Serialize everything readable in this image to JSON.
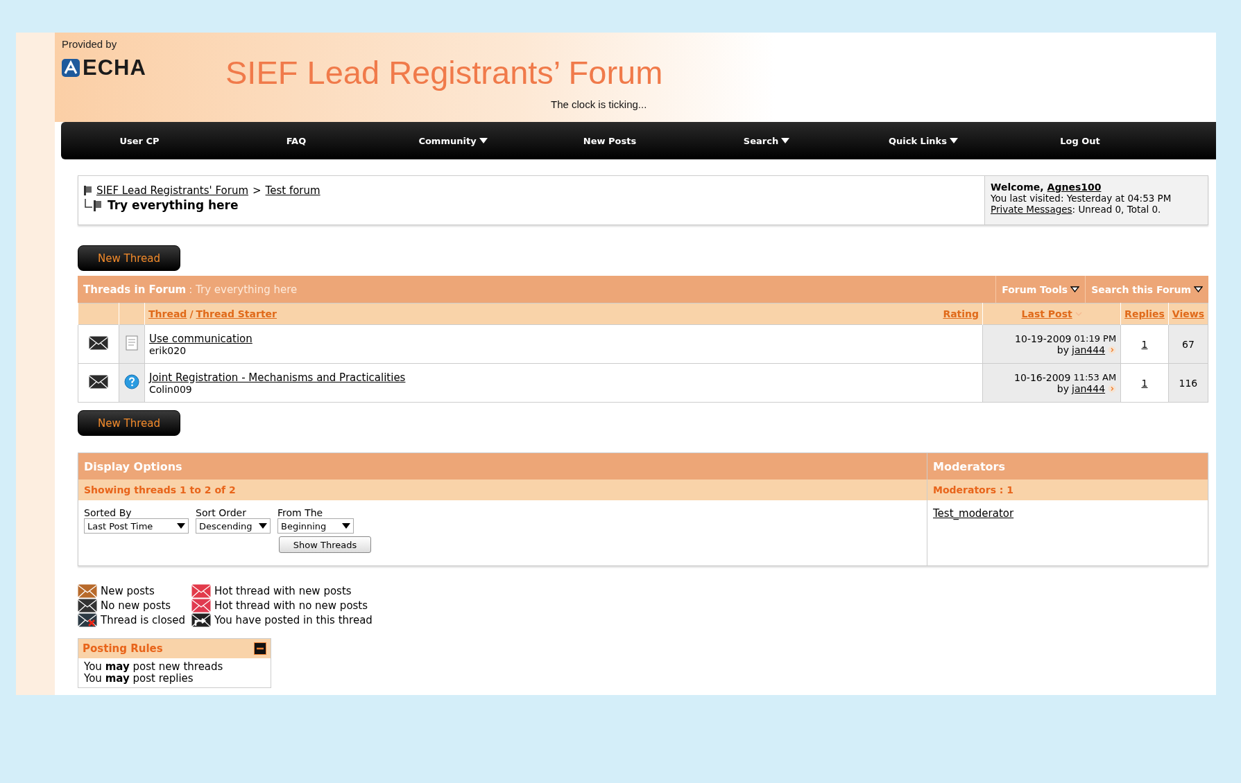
{
  "header": {
    "provided_by": "Provided by",
    "logo": "ECHA",
    "title": "SIEF Lead Registrants’ Forum",
    "tagline": "The clock is ticking..."
  },
  "nav": [
    {
      "label": "User CP",
      "dropdown": false
    },
    {
      "label": "FAQ",
      "dropdown": false
    },
    {
      "label": "Community",
      "dropdown": true
    },
    {
      "label": "New Posts",
      "dropdown": false
    },
    {
      "label": "Search",
      "dropdown": true
    },
    {
      "label": "Quick Links",
      "dropdown": true
    },
    {
      "label": "Log Out",
      "dropdown": false
    }
  ],
  "breadcrumb": {
    "parent": "SIEF Lead Registrants' Forum",
    "separator": ">",
    "child": "Test forum",
    "current": "Try everything here"
  },
  "welcome": {
    "greeting": "Welcome,",
    "user": "Agnes100",
    "line2": "You last visited: Yesterday at 04:53 PM",
    "pm_link": "Private Messages",
    "pm_status": ": Unread 0, Total 0."
  },
  "new_thread_button": "New Thread",
  "threads": {
    "title": "Threads in Forum",
    "subtitle": ": Try everything here",
    "tools": [
      "Forum Tools",
      "Search this Forum"
    ],
    "columns": {
      "thread": "Thread",
      "sep": "/",
      "starter": "Thread Starter",
      "rating": "Rating",
      "last_post": "Last Post",
      "replies": "Replies",
      "views": "Views"
    },
    "rows": [
      {
        "kind": "document",
        "title": "Use communication",
        "starter": "erik020",
        "date": "10-19-2009",
        "time": "01:19 PM",
        "by": "by",
        "last_user": "jan444",
        "replies": "1",
        "views": "67"
      },
      {
        "kind": "question",
        "title": "Joint Registration - Mechanisms and Practicalities",
        "starter": "Colin009",
        "date": "10-16-2009",
        "time": "11:53 AM",
        "by": "by",
        "last_user": "jan444",
        "replies": "1",
        "views": "116"
      }
    ]
  },
  "new_thread_button_2": "New Thread",
  "display_options": {
    "title": "Display Options",
    "showing": "Showing threads 1 to 2 of 2",
    "fields": [
      {
        "label": "Sorted By",
        "value": "Last Post Time"
      },
      {
        "label": "Sort Order",
        "value": "Descending"
      },
      {
        "label": "From The",
        "value": "Beginning"
      }
    ],
    "button": "Show Threads"
  },
  "moderators": {
    "title": "Moderators",
    "count": "Moderators : 1",
    "names": [
      "Test_moderator"
    ]
  },
  "legend": [
    {
      "kind": "new",
      "label": "New posts"
    },
    {
      "kind": "hot_new",
      "label": "Hot thread with new posts"
    },
    {
      "kind": "none",
      "label": "No new posts"
    },
    {
      "kind": "hot_none",
      "label": "Hot thread with no new posts"
    },
    {
      "kind": "closed",
      "label": "Thread is closed"
    },
    {
      "kind": "posted",
      "label": "You have posted in this thread"
    }
  ],
  "posting_rules": {
    "title": "Posting Rules",
    "expanded": true,
    "lines": [
      "You **may** post new threads",
      "You **may** post replies"
    ]
  }
}
